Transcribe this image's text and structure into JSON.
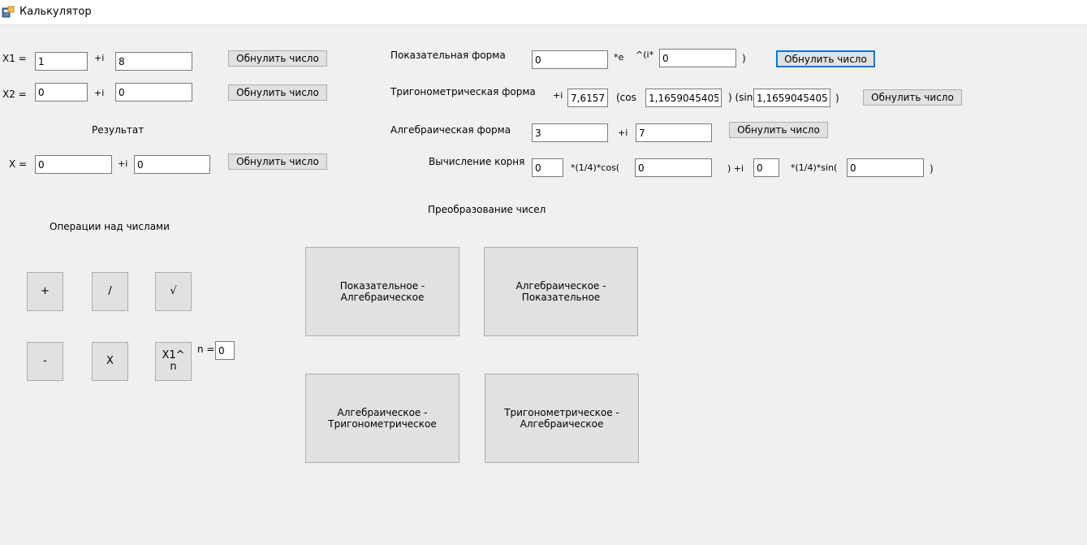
{
  "window": {
    "title": "Калькулятор"
  },
  "operands": {
    "x1_label": "X1 =",
    "x1_real": "1",
    "x1_i_label": "+i",
    "x1_imag": "8",
    "x1_reset": "Обнулить число",
    "x2_label": "X2 =",
    "x2_real": "0",
    "x2_i_label": "+i",
    "x2_imag": "0",
    "x2_reset": "Обнулить число"
  },
  "result": {
    "heading": "Результат",
    "x_label": "X =",
    "x_real": "0",
    "x_i_label": "+i",
    "x_imag": "0",
    "reset": "Обнулить число"
  },
  "forms": {
    "exponential": {
      "label": "Показательная форма",
      "modulus": "0",
      "e_label": "*e",
      "power_label": "^(i*",
      "angle": "0",
      "close": ")",
      "reset": "Обнулить число"
    },
    "trigonometric": {
      "label": "Тригонометрическая форма",
      "plus_i": "+i",
      "modulus": "7,6157",
      "cos_label": "(cos",
      "cos_value": "1,1659045405",
      "sin_label": ") (sin",
      "sin_value": "1,1659045405",
      "close": ")",
      "reset": "Обнулить число"
    },
    "algebraic": {
      "label": "Алгебраическая форма",
      "real": "3",
      "i_label": "+i",
      "imag": "7",
      "reset": "Обнулить число"
    },
    "root": {
      "label": "Вычисление корня",
      "coef": "0",
      "cos_label": "*(1/4)*cos(",
      "cos_value": "0",
      "plus_i": ") +i",
      "coef2": "0",
      "sin_label": "*(1/4)*sin(",
      "sin_value": "0",
      "close": ")"
    }
  },
  "operations": {
    "heading": "Операции над числами",
    "plus": "+",
    "divide": "/",
    "sqrt": "√",
    "minus": "-",
    "multiply": "X",
    "power": "X1^\nn",
    "n_label": "n =",
    "n_value": "0"
  },
  "conversions": {
    "heading": "Преобразование чисел",
    "exp_to_alg": "Показательное -\nАлгебраическое",
    "alg_to_exp": "Алгебраическое -\nПоказательное",
    "alg_to_trig": "Алгебраическое -\nТригонометрическое",
    "trig_to_alg": "Тригонометрическое -\nАлгебраическое"
  },
  "icons": {
    "app": "calculator-app-icon"
  }
}
